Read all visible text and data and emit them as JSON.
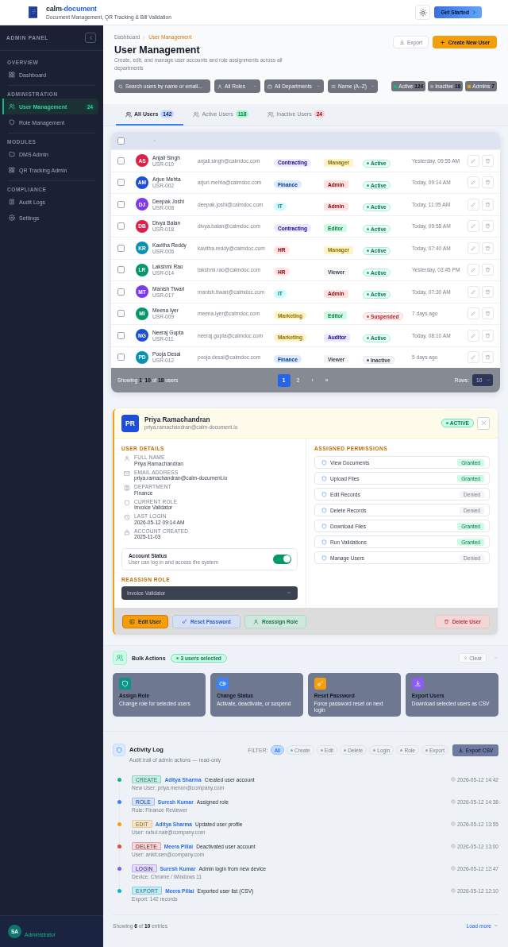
{
  "header": {
    "brand": {
      "prefix": "calm",
      "accent": "-document"
    },
    "tagline": "Document Management, QR Tracking & Bill Validation",
    "cta": "Get Started"
  },
  "sidebar": {
    "title": "ADMIN PANEL",
    "sections": [
      {
        "label": "OVERVIEW",
        "items": [
          {
            "label": "Dashboard",
            "selected": false
          }
        ]
      },
      {
        "label": "ADMINISTRATION",
        "items": [
          {
            "label": "User Management",
            "selected": true,
            "badge": "24"
          },
          {
            "label": "Role Management",
            "selected": false
          }
        ]
      },
      {
        "label": "MODULES",
        "items": [
          {
            "label": "DMS Admin",
            "selected": false
          },
          {
            "label": "QR Tracking Admin",
            "selected": false
          }
        ]
      },
      {
        "label": "COMPLIANCE",
        "items": [
          {
            "label": "Audit Logs",
            "selected": false
          },
          {
            "label": "Settings",
            "selected": false
          }
        ]
      }
    ],
    "user": {
      "initials": "SA",
      "role": "Administrator"
    }
  },
  "page": {
    "breadcrumb": [
      "Dashboard",
      "User Management"
    ],
    "title": "User Management",
    "subtitle": "Create, edit, and manage user accounts and role assignments across all departments",
    "export": "Export",
    "create": "Create New User"
  },
  "filters": {
    "search": {
      "placeholder": "Search users by name or email..."
    },
    "role": "All Roles",
    "department": "All Departments",
    "sort": "Name (A–Z)",
    "stats": [
      {
        "label": "Active",
        "count": "124",
        "color": "#10b981"
      },
      {
        "label": "Inactive",
        "count": "18",
        "color": "#9ca3af"
      },
      {
        "label": "Admins",
        "count": "7",
        "color": "#f59e0b"
      }
    ]
  },
  "tabs": [
    {
      "label": "All Users",
      "count": "142",
      "selected": true,
      "color": "#c7d2fe"
    },
    {
      "label": "Active Users",
      "count": "118",
      "selected": false,
      "color": "#a7f3d0"
    },
    {
      "label": "Inactive Users",
      "count": "24",
      "selected": false,
      "color": "#fecdd3"
    }
  ],
  "table": {
    "all_checked": false,
    "rows": [
      {
        "initials": "AS",
        "color": "#e11d48",
        "name": "Anjali Singh",
        "id": "USR-010",
        "email": "anjali.singh@calmdoc.com",
        "department": {
          "label": "Contracting",
          "color": "#ede9fe"
        },
        "role": {
          "label": "Manager",
          "color": "#fef3c7"
        },
        "status": {
          "label": "Active",
          "kind": "active"
        },
        "last_login": "Yesterday, 09:55 AM",
        "checked": false
      },
      {
        "initials": "AM",
        "color": "#1d4ed8",
        "name": "Arjun Mehta",
        "id": "USR-002",
        "email": "arjun.mehta@calmdoc.com",
        "department": {
          "label": "Finance",
          "color": "#dbeafe"
        },
        "role": {
          "label": "Admin",
          "color": "#fee2e2"
        },
        "status": {
          "label": "Active",
          "kind": "active"
        },
        "last_login": "Today, 09:14 AM",
        "checked": false
      },
      {
        "initials": "DJ",
        "color": "#7c3aed",
        "name": "Deepak Joshi",
        "id": "USR-008",
        "email": "deepak.joshi@calmdoc.com",
        "department": {
          "label": "IT",
          "color": "#cffafe"
        },
        "role": {
          "label": "Admin",
          "color": "#fee2e2"
        },
        "status": {
          "label": "Active",
          "kind": "active"
        },
        "last_login": "Today, 11:05 AM",
        "checked": false
      },
      {
        "initials": "DB",
        "color": "#e11d48",
        "name": "Divya Balan",
        "id": "USR-018",
        "email": "divya.balan@calmdoc.com",
        "department": {
          "label": "Contracting",
          "color": "#ede9fe"
        },
        "role": {
          "label": "Editor",
          "color": "#d1fae5"
        },
        "status": {
          "label": "Active",
          "kind": "active"
        },
        "last_login": "Today, 09:58 AM",
        "checked": false
      },
      {
        "initials": "KR",
        "color": "#0891b2",
        "name": "Kavitha Reddy",
        "id": "USR-006",
        "email": "kavitha.reddy@calmdoc.com",
        "department": {
          "label": "HR",
          "color": "#ffe4e6"
        },
        "role": {
          "label": "Manager",
          "color": "#fef3c7"
        },
        "status": {
          "label": "Active",
          "kind": "active"
        },
        "last_login": "Today, 07:40 AM",
        "checked": false
      },
      {
        "initials": "LR",
        "color": "#059669",
        "name": "Lakshmi Rao",
        "id": "USR-014",
        "email": "lakshmi.rao@calmdoc.com",
        "department": {
          "label": "HR",
          "color": "#ffe4e6"
        },
        "role": {
          "label": "Viewer",
          "color": "#f3f4f6"
        },
        "status": {
          "label": "Active",
          "kind": "active"
        },
        "last_login": "Yesterday, 03:45 PM",
        "checked": false
      },
      {
        "initials": "MT",
        "color": "#7c3aed",
        "name": "Manish Tiwari",
        "id": "USR-017",
        "email": "manish.tiwari@calmdoc.com",
        "department": {
          "label": "IT",
          "color": "#cffafe"
        },
        "role": {
          "label": "Admin",
          "color": "#fee2e2"
        },
        "status": {
          "label": "Active",
          "kind": "active"
        },
        "last_login": "Today, 07:30 AM",
        "checked": false
      },
      {
        "initials": "MI",
        "color": "#059669",
        "name": "Meena Iyer",
        "id": "USR-009",
        "email": "meena.iyer@calmdoc.com",
        "department": {
          "label": "Marketing",
          "color": "#fef3c7"
        },
        "role": {
          "label": "Editor",
          "color": "#d1fae5"
        },
        "status": {
          "label": "Suspended",
          "kind": "suspended"
        },
        "last_login": "7 days ago",
        "checked": false
      },
      {
        "initials": "NG",
        "color": "#1d4ed8",
        "name": "Neeraj Gupta",
        "id": "USR-011",
        "email": "neeraj.gupta@calmdoc.com",
        "department": {
          "label": "Marketing",
          "color": "#fef3c7"
        },
        "role": {
          "label": "Auditor",
          "color": "#ede9fe"
        },
        "status": {
          "label": "Active",
          "kind": "active"
        },
        "last_login": "Today, 08:10 AM",
        "checked": false
      },
      {
        "initials": "PD",
        "color": "#0891b2",
        "name": "Pooja Desai",
        "id": "USR-012",
        "email": "pooja.desai@calmdoc.com",
        "department": {
          "label": "Finance",
          "color": "#dbeafe"
        },
        "role": {
          "label": "Viewer",
          "color": "#f3f4f6"
        },
        "status": {
          "label": "Inactive",
          "kind": "inactive"
        },
        "last_login": "5 days ago",
        "checked": false
      }
    ],
    "footer": {
      "summary": "Showing **1**–**10** of **18** users",
      "pages": [
        {
          "label": "1",
          "selected": true
        },
        {
          "label": "2",
          "selected": false
        }
      ],
      "next": "›",
      "last": "»",
      "rows_label": "Rows:",
      "rows_value": "10"
    }
  },
  "profile": {
    "initials": "PR",
    "name": "Priya Ramachandran",
    "email": "priya.ramachandran@calm-document.io",
    "status": "ACTIVE",
    "details_title": "USER DETAILS",
    "details": [
      {
        "label": "FULL NAME",
        "value": "Priya Ramachandran"
      },
      {
        "label": "EMAIL ADDRESS",
        "value": "priya.ramachandran@calm-document.io"
      },
      {
        "label": "DEPARTMENT",
        "value": "Finance"
      },
      {
        "label": "CURRENT ROLE",
        "value": "Invoice Validator"
      },
      {
        "label": "LAST LOGIN",
        "value": "2026-05-12 09:14 AM"
      },
      {
        "label": "ACCOUNT CREATED",
        "value": "2025-11-03"
      }
    ],
    "account_status": {
      "title": "Account Status",
      "description": "User can log in and access the system",
      "on": true
    },
    "reassign_title": "REASSIGN ROLE",
    "reassign_value": "Invoice Validator",
    "permissions_title": "ASSIGNED PERMISSIONS",
    "permissions": [
      {
        "label": "View Documents",
        "status": "Granted",
        "granted": true
      },
      {
        "label": "Upload Files",
        "status": "Granted",
        "granted": true
      },
      {
        "label": "Edit Records",
        "status": "Denied",
        "granted": false
      },
      {
        "label": "Delete Records",
        "status": "Denied",
        "granted": false
      },
      {
        "label": "Download Files",
        "status": "Granted",
        "granted": true
      },
      {
        "label": "Run Validations",
        "status": "Granted",
        "granted": true
      },
      {
        "label": "Manage Users",
        "status": "Denied",
        "granted": false
      }
    ],
    "actions": [
      {
        "label": "Edit User",
        "kind": "edit"
      },
      {
        "label": "Reset Password",
        "kind": "reset"
      },
      {
        "label": "Reassign Role",
        "kind": "reassign"
      },
      {
        "label": "Delete User",
        "kind": "delete"
      }
    ]
  },
  "bulk_actions": {
    "title": "Bulk Actions",
    "selected_count": "3 users selected",
    "clear": "Clear",
    "cards": [
      {
        "title": "Assign Role",
        "description": "Change role for selected users",
        "color": "#0d9488"
      },
      {
        "title": "Change Status",
        "description": "Activate, deactivate, or suspend",
        "color": "#3b82f6"
      },
      {
        "title": "Reset Password",
        "description": "Force password reset on next login",
        "color": "#f59e0b"
      },
      {
        "title": "Export Users",
        "description": "Download selected users as CSV",
        "color": "#8b5cf6"
      }
    ]
  },
  "activity_log": {
    "title": "Activity Log",
    "subtitle": "Audit trail of admin actions — read-only",
    "filter_label": "FILTER:",
    "filters": [
      {
        "label": "All",
        "kind": "all",
        "selected": true
      },
      {
        "label": "Create",
        "kind": "type",
        "selected": false
      },
      {
        "label": "Edit",
        "kind": "type",
        "selected": false
      },
      {
        "label": "Delete",
        "kind": "type",
        "selected": false
      },
      {
        "label": "Login",
        "kind": "type",
        "selected": false
      },
      {
        "label": "Role",
        "kind": "type",
        "selected": false
      },
      {
        "label": "Export",
        "kind": "type",
        "selected": false
      }
    ],
    "export": "Export CSV",
    "entries": [
      {
        "tag": "CREATE",
        "color": "#10b981",
        "actor": "Aditya Sharma",
        "action": "Created user account",
        "detail": "New User: priya.menon@company.com",
        "time": "2026-05-12 14:42"
      },
      {
        "tag": "ROLE",
        "color": "#3b82f6",
        "actor": "Suresh Kumar",
        "action": "Assigned role",
        "detail": "Role: Finance Reviewer",
        "time": "2026-05-12 14:38"
      },
      {
        "tag": "EDIT",
        "color": "#f59e0b",
        "actor": "Aditya Sharma",
        "action": "Updated user profile",
        "detail": "User: rahul.nair@company.com",
        "time": "2026-05-12 13:55"
      },
      {
        "tag": "DELETE",
        "color": "#ef4444",
        "actor": "Meera Pillai",
        "action": "Deactivated user account",
        "detail": "User: ankit.sen@company.com",
        "time": "2026-05-12 13:00"
      },
      {
        "tag": "LOGIN",
        "color": "#8b5cf6",
        "actor": "Suresh Kumar",
        "action": "Admin login from new device",
        "detail": "Device: Chrome / Windows 11",
        "time": "2026-05-12 12:47"
      },
      {
        "tag": "EXPORT",
        "color": "#06b6d4",
        "actor": "Meera Pillai",
        "action": "Exported user list (CSV)",
        "detail": "Export: 142 records",
        "time": "2026-05-12 12:10"
      }
    ],
    "footer": {
      "summary": "Showing **6** of **10** entries",
      "load_more": "Load more"
    }
  }
}
